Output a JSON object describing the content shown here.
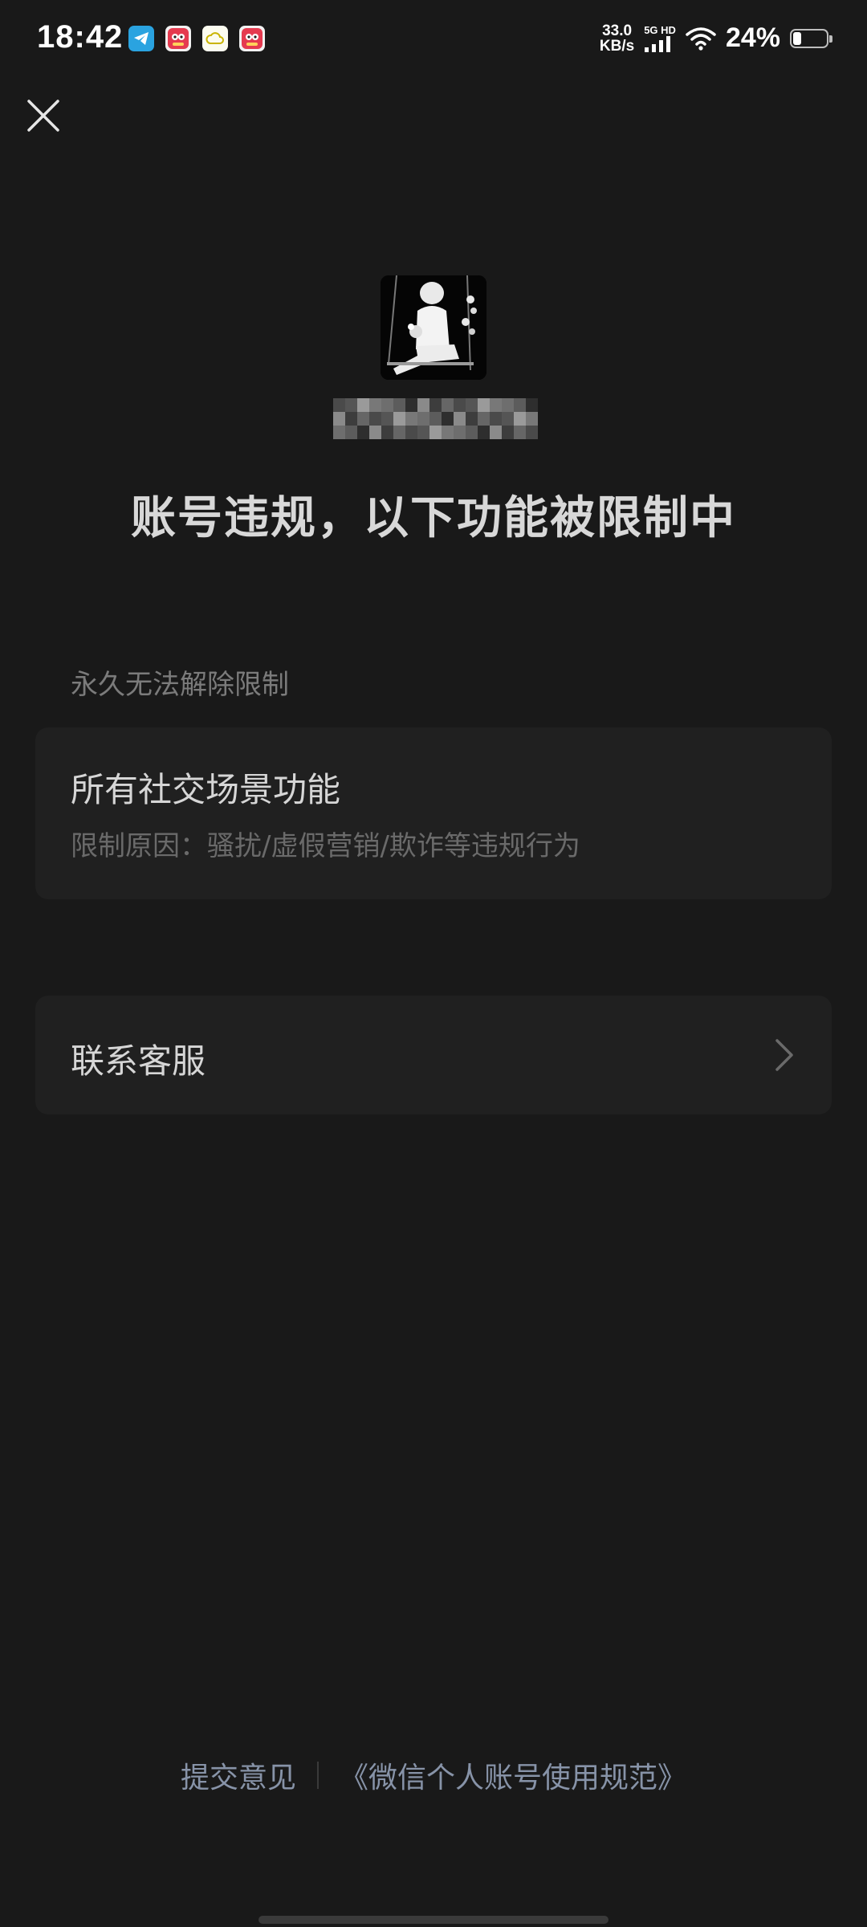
{
  "status_bar": {
    "time": "18:42",
    "net_speed_value": "33.0",
    "net_speed_unit": "KB/s",
    "signal_label": "5G HD",
    "battery_percent": "24%",
    "battery_level": 0.24,
    "notification_icons": [
      "telegram-icon",
      "app-icon",
      "weather-icon",
      "app-icon"
    ]
  },
  "page": {
    "title": "账号违规，以下功能被限制中",
    "section_label": "永久无法解除限制",
    "restriction": {
      "name": "所有社交场景功能",
      "reason": "限制原因：骚扰/虚假营销/欺诈等违规行为"
    },
    "contact_label": "联系客服"
  },
  "footer": {
    "feedback_label": "提交意见",
    "policy_label": "《微信个人账号使用规范》"
  },
  "colors": {
    "background": "#191919",
    "card": "#202020",
    "link": "#8793a8"
  }
}
